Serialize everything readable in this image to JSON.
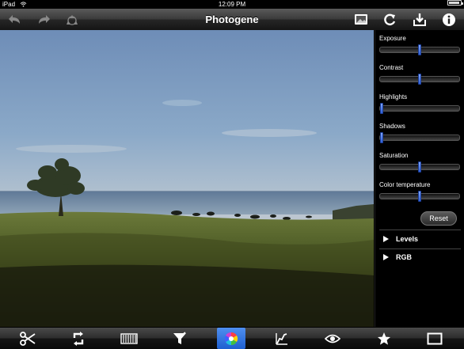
{
  "status": {
    "device": "iPad",
    "time": "12:09 PM"
  },
  "nav": {
    "title": "Photogene"
  },
  "adjustments": [
    {
      "label": "Exposure",
      "level": 0.5
    },
    {
      "label": "Contrast",
      "level": 0.5
    },
    {
      "label": "Highlights",
      "level": 0.0
    },
    {
      "label": "Shadows",
      "level": 0.0
    },
    {
      "label": "Saturation",
      "level": 0.5
    },
    {
      "label": "Color temperature",
      "level": 0.5
    }
  ],
  "reset_label": "Reset",
  "sections": [
    {
      "label": "Levels"
    },
    {
      "label": "RGB"
    }
  ],
  "toolbar": {
    "tools": [
      "scissors-icon",
      "rotate-icon",
      "frames-icon",
      "filter-icon",
      "color-wheel-icon",
      "curves-icon",
      "eye-icon",
      "star-icon",
      "square-icon"
    ],
    "active_tool": "color-wheel-icon"
  },
  "colors": {
    "accent": "#2f6fe0",
    "thumb": "#4a78e8"
  }
}
